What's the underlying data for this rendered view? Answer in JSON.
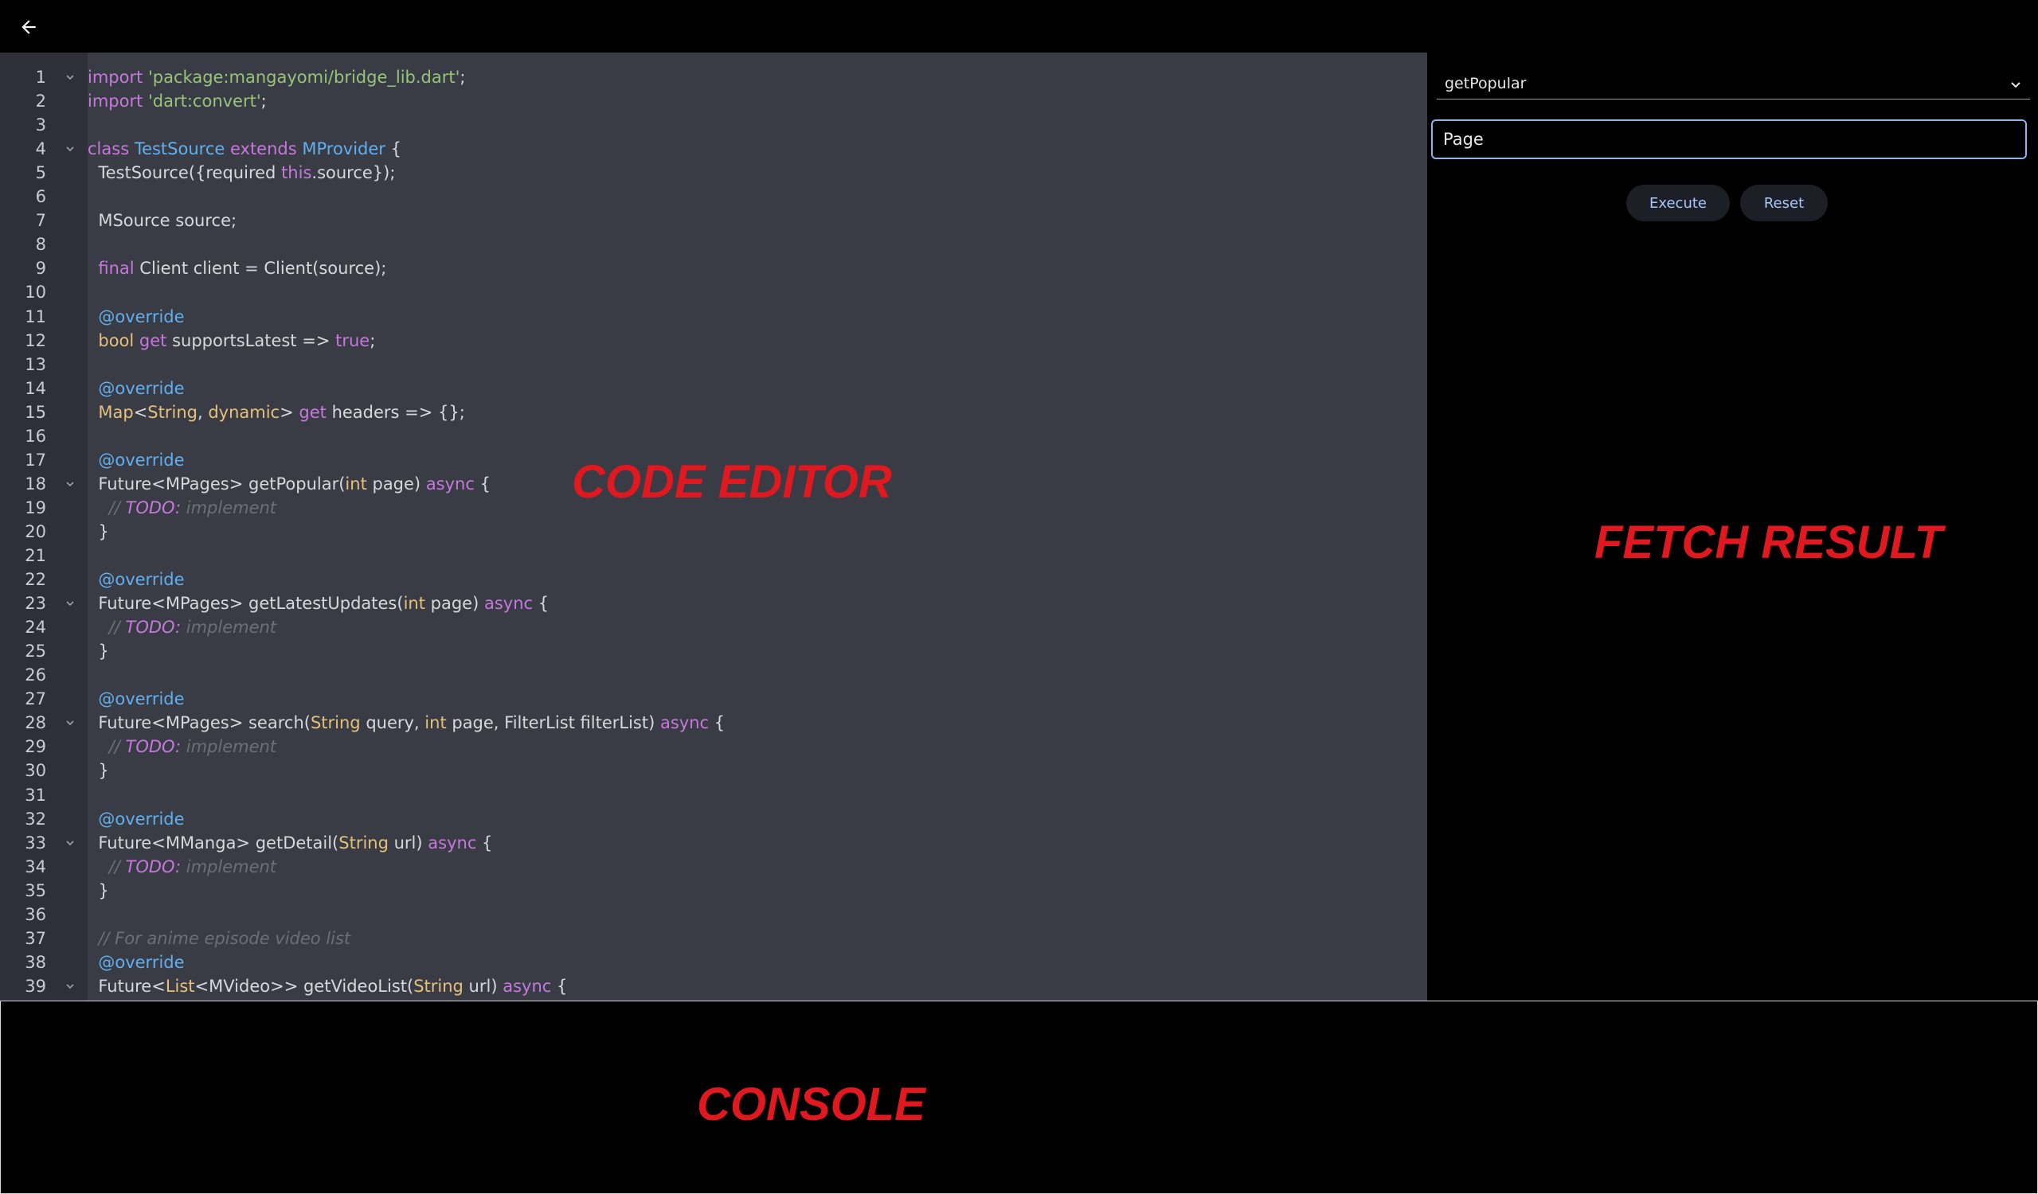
{
  "app": {
    "back_icon": "arrow-left-icon"
  },
  "editor": {
    "overlay_label": "CODE EDITOR",
    "fold_lines": [
      1,
      4,
      18,
      23,
      28,
      33,
      39
    ],
    "lines": [
      [
        [
          "import ",
          "kw"
        ],
        [
          "'package:mangayomi/bridge_lib.dart'",
          "st"
        ],
        [
          ";",
          ""
        ]
      ],
      [
        [
          "import ",
          "kw"
        ],
        [
          "'dart:convert'",
          "st"
        ],
        [
          ";",
          ""
        ]
      ],
      [],
      [
        [
          "class ",
          "kw"
        ],
        [
          "TestSource ",
          "cls"
        ],
        [
          "extends ",
          "kw"
        ],
        [
          "MProvider",
          "cls"
        ],
        [
          " {",
          ""
        ]
      ],
      [
        [
          "  TestSource({required ",
          ""
        ],
        [
          "this",
          "kw"
        ],
        [
          ".source});",
          ""
        ]
      ],
      [],
      [
        [
          "  MSource source;",
          ""
        ]
      ],
      [],
      [
        [
          "  ",
          ""
        ],
        [
          "final ",
          "kw"
        ],
        [
          "Client client = Client(source);",
          ""
        ]
      ],
      [],
      [
        [
          "  ",
          ""
        ],
        [
          "@override",
          "an"
        ]
      ],
      [
        [
          "  ",
          ""
        ],
        [
          "bool ",
          "ty"
        ],
        [
          "get ",
          "kw"
        ],
        [
          "supportsLatest => ",
          ""
        ],
        [
          "true",
          "kw"
        ],
        [
          ";",
          ""
        ]
      ],
      [],
      [
        [
          "  ",
          ""
        ],
        [
          "@override",
          "an"
        ]
      ],
      [
        [
          "  ",
          ""
        ],
        [
          "Map",
          "ty"
        ],
        [
          "<",
          ""
        ],
        [
          "String",
          "ty"
        ],
        [
          ", ",
          ""
        ],
        [
          "dynamic",
          "ty"
        ],
        [
          "> ",
          ""
        ],
        [
          "get ",
          "kw"
        ],
        [
          "headers => {};",
          ""
        ]
      ],
      [],
      [
        [
          "  ",
          ""
        ],
        [
          "@override",
          "an"
        ]
      ],
      [
        [
          "  Future<MPages> getPopular(",
          ""
        ],
        [
          "int ",
          "ty"
        ],
        [
          "page) ",
          ""
        ],
        [
          "async ",
          "kw"
        ],
        [
          "{",
          ""
        ]
      ],
      [
        [
          "    ",
          ""
        ],
        [
          "// ",
          "cm"
        ],
        [
          "TODO:",
          "todo"
        ],
        [
          " implement",
          "cm"
        ]
      ],
      [
        [
          "  }",
          ""
        ]
      ],
      [],
      [
        [
          "  ",
          ""
        ],
        [
          "@override",
          "an"
        ]
      ],
      [
        [
          "  Future<MPages> getLatestUpdates(",
          ""
        ],
        [
          "int ",
          "ty"
        ],
        [
          "page) ",
          ""
        ],
        [
          "async ",
          "kw"
        ],
        [
          "{",
          ""
        ]
      ],
      [
        [
          "    ",
          ""
        ],
        [
          "// ",
          "cm"
        ],
        [
          "TODO:",
          "todo"
        ],
        [
          " implement",
          "cm"
        ]
      ],
      [
        [
          "  }",
          ""
        ]
      ],
      [],
      [
        [
          "  ",
          ""
        ],
        [
          "@override",
          "an"
        ]
      ],
      [
        [
          "  Future<MPages> search(",
          ""
        ],
        [
          "String ",
          "ty"
        ],
        [
          "query, ",
          ""
        ],
        [
          "int ",
          "ty"
        ],
        [
          "page, FilterList filterList) ",
          ""
        ],
        [
          "async ",
          "kw"
        ],
        [
          "{",
          ""
        ]
      ],
      [
        [
          "    ",
          ""
        ],
        [
          "// ",
          "cm"
        ],
        [
          "TODO:",
          "todo"
        ],
        [
          " implement",
          "cm"
        ]
      ],
      [
        [
          "  }",
          ""
        ]
      ],
      [],
      [
        [
          "  ",
          ""
        ],
        [
          "@override",
          "an"
        ]
      ],
      [
        [
          "  Future<MManga> getDetail(",
          ""
        ],
        [
          "String ",
          "ty"
        ],
        [
          "url) ",
          ""
        ],
        [
          "async ",
          "kw"
        ],
        [
          "{",
          ""
        ]
      ],
      [
        [
          "    ",
          ""
        ],
        [
          "// ",
          "cm"
        ],
        [
          "TODO:",
          "todo"
        ],
        [
          " implement",
          "cm"
        ]
      ],
      [
        [
          "  }",
          ""
        ]
      ],
      [],
      [
        [
          "  ",
          ""
        ],
        [
          "// For anime episode video list",
          "cm"
        ]
      ],
      [
        [
          "  ",
          ""
        ],
        [
          "@override",
          "an"
        ]
      ],
      [
        [
          "  Future<",
          ""
        ],
        [
          "List",
          "ty"
        ],
        [
          "<MVideo>> getVideoList(",
          ""
        ],
        [
          "String ",
          "ty"
        ],
        [
          "url) ",
          ""
        ],
        [
          "async ",
          "kw"
        ],
        [
          "{",
          ""
        ]
      ],
      [],
      []
    ]
  },
  "fetch": {
    "method": "getPopular",
    "page_placeholder": "Page",
    "execute_label": "Execute",
    "reset_label": "Reset",
    "overlay_label": "FETCH RESULT"
  },
  "console": {
    "overlay_label": "CONSOLE"
  }
}
